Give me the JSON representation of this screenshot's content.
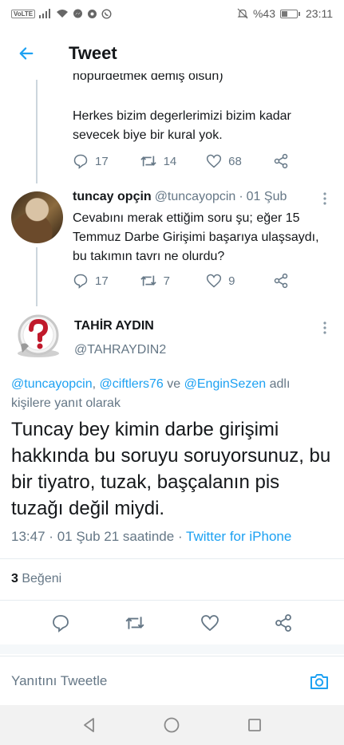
{
  "status_bar": {
    "battery_text": "%43",
    "time": "23:11",
    "battery_level": 0.43,
    "volte_label": "VoLTE",
    "icons": [
      "volte-icon",
      "signal-icon",
      "wifi-icon",
      "messenger-icon",
      "settings-icon",
      "whatsapp-icon",
      "mute-icon",
      "battery-icon"
    ]
  },
  "header": {
    "title": "Tweet",
    "back_icon": "arrow-left-icon"
  },
  "previous_tweet": {
    "clipped_text": "höpürdetmek demiş olsun)",
    "text": "Herkes bizim degerlerimizi bizim kadar sevecek biye bir kural yok.",
    "reply_count": "17",
    "retweet_count": "14",
    "like_count": "68"
  },
  "reply_tweet": {
    "name": "tuncay opçin",
    "handle": "@tuncayopcin",
    "separator": "·",
    "date": "01 Şub",
    "text": "Cevabını merak ettiğim soru şu; eğer 15 Temmuz Darbe Girişimi başarıya ulaşsaydı, bu takımın tavrı ne olurdu?",
    "reply_count": "17",
    "retweet_count": "7",
    "like_count": "9"
  },
  "main_tweet": {
    "name": "TAHİR AYDIN",
    "handle": "@TAHRAYDIN2",
    "reply_to_mentions": [
      "@tuncayopcin",
      "@ciftlers76",
      "@EnginSezen"
    ],
    "reply_to_comma": ",",
    "reply_to_and": "ve",
    "reply_to_suffix": "adlı kişilere yanıt olarak",
    "text": "Tuncay bey kimin darbe girişimi hakkında bu soruyu soruyorsunuz, bu bir tiyatro, tuzak, başçalanın pis tuzağı değil miydi.",
    "time": "13:47",
    "separator": "·",
    "date": "01 Şub 21 saatinde",
    "client": "Twitter for iPhone",
    "like_count": "3",
    "like_label": "Beğeni"
  },
  "reply_box": {
    "placeholder": "Yanıtını Tweetle"
  },
  "colors": {
    "accent": "#1da1f2",
    "secondary_text": "#657786",
    "thread_line": "#ccd6dd"
  }
}
